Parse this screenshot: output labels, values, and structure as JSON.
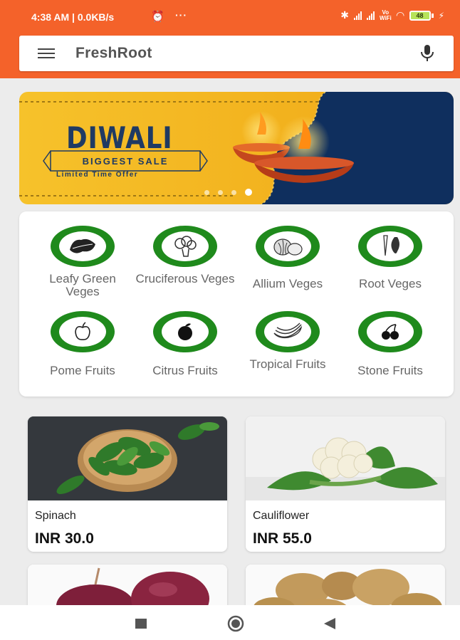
{
  "status_bar": {
    "time": "4:38 AM | 0.0KB/s",
    "alarm_icon": "alarm-icon",
    "more": "···",
    "volte": [
      "Vo",
      "WiFi"
    ],
    "battery": "48"
  },
  "header": {
    "title": "FreshRoot",
    "menu_icon": "hamburger-menu-icon",
    "mic_icon": "microphone-icon"
  },
  "banner": {
    "title": "DIWALI",
    "tag": "BIGGEST SALE",
    "subtitle": "Limited Time Offer",
    "slide_count": 4,
    "active_slide": 4
  },
  "categories": [
    {
      "label": "Leafy Green Veges",
      "icon": "leafy-green-icon"
    },
    {
      "label": "Cruciferous Veges",
      "icon": "cauliflower-icon"
    },
    {
      "label": "Allium Veges",
      "icon": "onion-garlic-icon"
    },
    {
      "label": "Root Veges",
      "icon": "root-vegetable-icon"
    },
    {
      "label": "Pome Fruits",
      "icon": "apple-icon"
    },
    {
      "label": "Citrus Fruits",
      "icon": "orange-icon"
    },
    {
      "label": "Tropical Fruits",
      "icon": "banana-icon"
    },
    {
      "label": "Stone Fruits",
      "icon": "cherry-icon"
    }
  ],
  "products": [
    {
      "name": "Spinach",
      "price": "INR 30.0"
    },
    {
      "name": "Cauliflower",
      "price": "INR 55.0"
    }
  ],
  "partial_products": [
    "onion",
    "potato"
  ],
  "nav": {
    "recents_icon": "recents-square-icon",
    "home_icon": "home-circle-icon",
    "back_icon": "back-triangle-icon"
  },
  "colors": {
    "accent": "#f4622a",
    "category_green": "#1f8a1c",
    "banner_yellow": "#f2b21e",
    "banner_navy": "#1f3a63"
  }
}
